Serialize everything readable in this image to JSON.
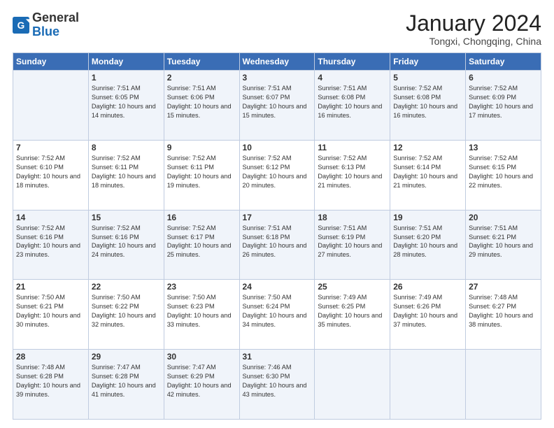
{
  "logo": {
    "general": "General",
    "blue": "Blue"
  },
  "header": {
    "month": "January 2024",
    "location": "Tongxi, Chongqing, China"
  },
  "weekdays": [
    "Sunday",
    "Monday",
    "Tuesday",
    "Wednesday",
    "Thursday",
    "Friday",
    "Saturday"
  ],
  "weeks": [
    [
      {
        "day": "",
        "sunrise": "",
        "sunset": "",
        "daylight": ""
      },
      {
        "day": "1",
        "sunrise": "Sunrise: 7:51 AM",
        "sunset": "Sunset: 6:05 PM",
        "daylight": "Daylight: 10 hours and 14 minutes."
      },
      {
        "day": "2",
        "sunrise": "Sunrise: 7:51 AM",
        "sunset": "Sunset: 6:06 PM",
        "daylight": "Daylight: 10 hours and 15 minutes."
      },
      {
        "day": "3",
        "sunrise": "Sunrise: 7:51 AM",
        "sunset": "Sunset: 6:07 PM",
        "daylight": "Daylight: 10 hours and 15 minutes."
      },
      {
        "day": "4",
        "sunrise": "Sunrise: 7:51 AM",
        "sunset": "Sunset: 6:08 PM",
        "daylight": "Daylight: 10 hours and 16 minutes."
      },
      {
        "day": "5",
        "sunrise": "Sunrise: 7:52 AM",
        "sunset": "Sunset: 6:08 PM",
        "daylight": "Daylight: 10 hours and 16 minutes."
      },
      {
        "day": "6",
        "sunrise": "Sunrise: 7:52 AM",
        "sunset": "Sunset: 6:09 PM",
        "daylight": "Daylight: 10 hours and 17 minutes."
      }
    ],
    [
      {
        "day": "7",
        "sunrise": "Sunrise: 7:52 AM",
        "sunset": "Sunset: 6:10 PM",
        "daylight": "Daylight: 10 hours and 18 minutes."
      },
      {
        "day": "8",
        "sunrise": "Sunrise: 7:52 AM",
        "sunset": "Sunset: 6:11 PM",
        "daylight": "Daylight: 10 hours and 18 minutes."
      },
      {
        "day": "9",
        "sunrise": "Sunrise: 7:52 AM",
        "sunset": "Sunset: 6:11 PM",
        "daylight": "Daylight: 10 hours and 19 minutes."
      },
      {
        "day": "10",
        "sunrise": "Sunrise: 7:52 AM",
        "sunset": "Sunset: 6:12 PM",
        "daylight": "Daylight: 10 hours and 20 minutes."
      },
      {
        "day": "11",
        "sunrise": "Sunrise: 7:52 AM",
        "sunset": "Sunset: 6:13 PM",
        "daylight": "Daylight: 10 hours and 21 minutes."
      },
      {
        "day": "12",
        "sunrise": "Sunrise: 7:52 AM",
        "sunset": "Sunset: 6:14 PM",
        "daylight": "Daylight: 10 hours and 21 minutes."
      },
      {
        "day": "13",
        "sunrise": "Sunrise: 7:52 AM",
        "sunset": "Sunset: 6:15 PM",
        "daylight": "Daylight: 10 hours and 22 minutes."
      }
    ],
    [
      {
        "day": "14",
        "sunrise": "Sunrise: 7:52 AM",
        "sunset": "Sunset: 6:16 PM",
        "daylight": "Daylight: 10 hours and 23 minutes."
      },
      {
        "day": "15",
        "sunrise": "Sunrise: 7:52 AM",
        "sunset": "Sunset: 6:16 PM",
        "daylight": "Daylight: 10 hours and 24 minutes."
      },
      {
        "day": "16",
        "sunrise": "Sunrise: 7:52 AM",
        "sunset": "Sunset: 6:17 PM",
        "daylight": "Daylight: 10 hours and 25 minutes."
      },
      {
        "day": "17",
        "sunrise": "Sunrise: 7:51 AM",
        "sunset": "Sunset: 6:18 PM",
        "daylight": "Daylight: 10 hours and 26 minutes."
      },
      {
        "day": "18",
        "sunrise": "Sunrise: 7:51 AM",
        "sunset": "Sunset: 6:19 PM",
        "daylight": "Daylight: 10 hours and 27 minutes."
      },
      {
        "day": "19",
        "sunrise": "Sunrise: 7:51 AM",
        "sunset": "Sunset: 6:20 PM",
        "daylight": "Daylight: 10 hours and 28 minutes."
      },
      {
        "day": "20",
        "sunrise": "Sunrise: 7:51 AM",
        "sunset": "Sunset: 6:21 PM",
        "daylight": "Daylight: 10 hours and 29 minutes."
      }
    ],
    [
      {
        "day": "21",
        "sunrise": "Sunrise: 7:50 AM",
        "sunset": "Sunset: 6:21 PM",
        "daylight": "Daylight: 10 hours and 30 minutes."
      },
      {
        "day": "22",
        "sunrise": "Sunrise: 7:50 AM",
        "sunset": "Sunset: 6:22 PM",
        "daylight": "Daylight: 10 hours and 32 minutes."
      },
      {
        "day": "23",
        "sunrise": "Sunrise: 7:50 AM",
        "sunset": "Sunset: 6:23 PM",
        "daylight": "Daylight: 10 hours and 33 minutes."
      },
      {
        "day": "24",
        "sunrise": "Sunrise: 7:50 AM",
        "sunset": "Sunset: 6:24 PM",
        "daylight": "Daylight: 10 hours and 34 minutes."
      },
      {
        "day": "25",
        "sunrise": "Sunrise: 7:49 AM",
        "sunset": "Sunset: 6:25 PM",
        "daylight": "Daylight: 10 hours and 35 minutes."
      },
      {
        "day": "26",
        "sunrise": "Sunrise: 7:49 AM",
        "sunset": "Sunset: 6:26 PM",
        "daylight": "Daylight: 10 hours and 37 minutes."
      },
      {
        "day": "27",
        "sunrise": "Sunrise: 7:48 AM",
        "sunset": "Sunset: 6:27 PM",
        "daylight": "Daylight: 10 hours and 38 minutes."
      }
    ],
    [
      {
        "day": "28",
        "sunrise": "Sunrise: 7:48 AM",
        "sunset": "Sunset: 6:28 PM",
        "daylight": "Daylight: 10 hours and 39 minutes."
      },
      {
        "day": "29",
        "sunrise": "Sunrise: 7:47 AM",
        "sunset": "Sunset: 6:28 PM",
        "daylight": "Daylight: 10 hours and 41 minutes."
      },
      {
        "day": "30",
        "sunrise": "Sunrise: 7:47 AM",
        "sunset": "Sunset: 6:29 PM",
        "daylight": "Daylight: 10 hours and 42 minutes."
      },
      {
        "day": "31",
        "sunrise": "Sunrise: 7:46 AM",
        "sunset": "Sunset: 6:30 PM",
        "daylight": "Daylight: 10 hours and 43 minutes."
      },
      {
        "day": "",
        "sunrise": "",
        "sunset": "",
        "daylight": ""
      },
      {
        "day": "",
        "sunrise": "",
        "sunset": "",
        "daylight": ""
      },
      {
        "day": "",
        "sunrise": "",
        "sunset": "",
        "daylight": ""
      }
    ]
  ]
}
